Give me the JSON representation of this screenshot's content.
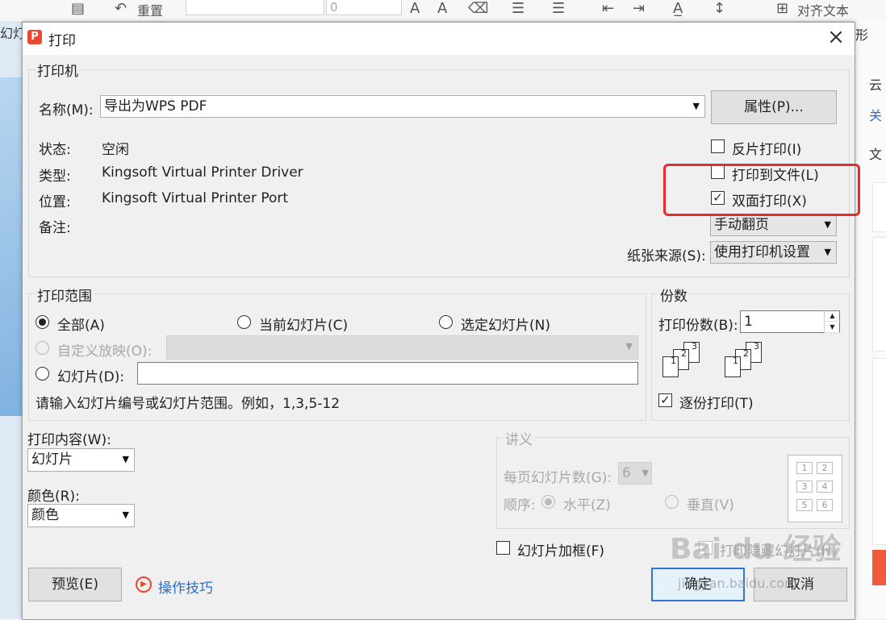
{
  "background": {
    "left_label": "幻灯",
    "toolbar_reset": "重置",
    "toolbar_size": "0",
    "toolbar_align": "对齐文本",
    "toolbar_shape": "形",
    "right_labels": [
      "云",
      "关",
      "文"
    ]
  },
  "dialog": {
    "title": "打印",
    "app_logo": "P",
    "close": "×"
  },
  "printer": {
    "group_label": "打印机",
    "name_label": "名称(M):",
    "name_value": "导出为WPS PDF",
    "properties_button": "属性(P)...",
    "status_label": "状态:",
    "status_value": "空闲",
    "type_label": "类型:",
    "type_value": "Kingsoft Virtual Printer Driver",
    "location_label": "位置:",
    "location_value": "Kingsoft Virtual Printer Port",
    "comment_label": "备注:",
    "reverse_print": "反片打印(I)",
    "print_to_file": "打印到文件(L)",
    "duplex": "双面打印(X)",
    "duplex_mode": "手动翻页",
    "paper_source_label": "纸张来源(S):",
    "paper_source_value": "使用打印机设置",
    "reverse_checked": false,
    "to_file_checked": false,
    "duplex_checked": true
  },
  "range": {
    "group_label": "打印范围",
    "all": "全部(A)",
    "current": "当前幻灯片(C)",
    "selected": "选定幻灯片(N)",
    "custom": "自定义放映(O):",
    "slides": "幻灯片(D):",
    "hint": "请输入幻灯片编号或幻灯片范围。例如，1,3,5-12",
    "selected_option": "all"
  },
  "copies": {
    "group_label": "份数",
    "count_label": "打印份数(B):",
    "count_value": "1",
    "collate": "逐份打印(T)",
    "collate_checked": true,
    "stack_pages": [
      "1",
      "2",
      "3"
    ]
  },
  "content": {
    "what_label": "打印内容(W):",
    "what_value": "幻灯片",
    "color_label": "颜色(R):",
    "color_value": "颜色"
  },
  "handout": {
    "group_label": "讲义",
    "per_page_label": "每页幻灯片数(G):",
    "per_page_value": "6",
    "order_label": "顺序:",
    "horizontal": "水平(Z)",
    "vertical": "垂直(V)",
    "grid_numbers": [
      "1",
      "2",
      "3",
      "4",
      "5",
      "6"
    ]
  },
  "options": {
    "frame_slides": "幻灯片加框(F)",
    "print_hidden": "打印隐藏幻灯片(H)"
  },
  "footer": {
    "preview_button": "预览(E)",
    "tips_link": "操作技巧",
    "ok_button": "确定",
    "cancel_button": "取消"
  },
  "watermark": {
    "main": "Bai du 经验",
    "sub": "jingyan.baidu.com"
  },
  "colors": {
    "highlight": "#e52b2b",
    "link": "#2a6fcf",
    "brand": "#e8492f"
  }
}
